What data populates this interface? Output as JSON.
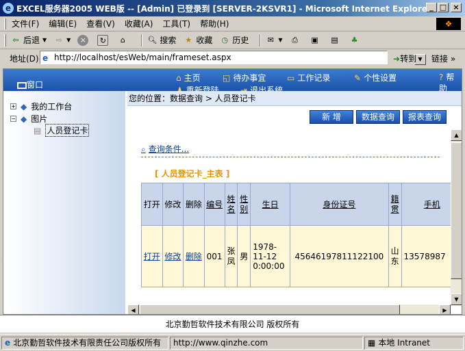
{
  "window": {
    "title": "EXCEL服务器2005 WEB版 -- [Admin] 已登录到 [SERVER-2KSVR1] - Microsoft Internet Explorer",
    "min": "_",
    "max": "□",
    "close": "×"
  },
  "menu": [
    "文件(F)",
    "编辑(E)",
    "查看(V)",
    "收藏(A)",
    "工具(T)",
    "帮助(H)"
  ],
  "toolbar": {
    "back": "后退",
    "search": "搜索",
    "favorites": "收藏",
    "history": "历史"
  },
  "address": {
    "label": "地址(D)",
    "url": "http://localhost/esWeb/main/frameset.aspx",
    "go": "转到",
    "links": "链接"
  },
  "appnav": {
    "window": "窗口",
    "home": "主页",
    "todo": "待办事宜",
    "worklog": "工作记录",
    "settings": "个性设置",
    "help": "帮助",
    "relogin": "重新登陆",
    "logout": "退出系统"
  },
  "tree": {
    "root": "我的工作台",
    "folder": "图片",
    "leaf": "人员登记卡"
  },
  "breadcrumb": "您的位置：数据查询 > 人员登记卡",
  "actions": {
    "add": "新 增",
    "query": "数据查询",
    "report": "报表查询"
  },
  "query_link": "查询条件...",
  "table": {
    "title": "[ 人员登记卡_主表 ]",
    "headers": [
      "打开",
      "修改",
      "删除",
      "编号",
      "姓名",
      "性别",
      "生日",
      "身份证号",
      "籍贯",
      "手机"
    ],
    "row": {
      "open": "打开",
      "edit": "修改",
      "delete": "删除",
      "no": "001",
      "name": "张凤",
      "gender": "男",
      "birthday": "1978-11-12 0:00:00",
      "id": "45646197811122100",
      "origin": "山东",
      "mobile": "13578987"
    }
  },
  "footer": "北京勤哲软件技术有限公司  版权所有",
  "status": {
    "text": "北京勤哲软件技术有限责任公司版权所有",
    "url": "http://www.qinzhe.com",
    "zone": "本地 Intranet"
  }
}
